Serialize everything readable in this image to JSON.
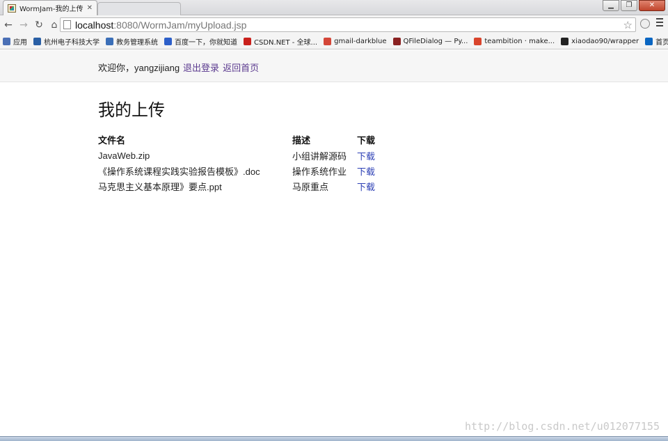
{
  "browser": {
    "active_tab_title": "WormJam-我的上传",
    "url_host": "localhost",
    "url_rest": ":8080/WormJam/myUpload.jsp",
    "bookmarks": [
      {
        "label": "应用",
        "icon": "apps-grid-icon",
        "color": "#4a6fb5"
      },
      {
        "label": "杭州电子科技大学",
        "icon": "hdu-logo-icon",
        "color": "#2a5fa5"
      },
      {
        "label": "教务管理系统",
        "icon": "document-icon",
        "color": "#3b6fb8"
      },
      {
        "label": "百度一下，你就知道",
        "icon": "baidu-paw-icon",
        "color": "#2d5fc9"
      },
      {
        "label": "CSDN.NET - 全球...",
        "icon": "csdn-icon",
        "color": "#c9201c"
      },
      {
        "label": "gmail-darkblue",
        "icon": "gmail-icon",
        "color": "#d44638"
      },
      {
        "label": "QFileDialog — Py...",
        "icon": "qt-doc-icon",
        "color": "#8a2222"
      },
      {
        "label": "teambition · make...",
        "icon": "teambition-icon",
        "color": "#d9442c"
      },
      {
        "label": "xiaodao90/wrapper",
        "icon": "github-icon",
        "color": "#222222"
      },
      {
        "label": "首页 - 知乎",
        "icon": "zhihu-icon",
        "color": "#0a66c2"
      }
    ],
    "bookmarks_overflow": "»"
  },
  "header": {
    "welcome_text": "欢迎你，yangzijiang",
    "logout_link": "退出登录",
    "home_link": "返回首页"
  },
  "main": {
    "title": "我的上传",
    "columns": [
      "文件名",
      "描述",
      "下载"
    ],
    "rows": [
      {
        "name": "JavaWeb.zip",
        "desc": "小组讲解源码",
        "download": "下载"
      },
      {
        "name": "《操作系统课程实践实验报告模板》.doc",
        "desc": "操作系统作业",
        "download": "下载"
      },
      {
        "name": "马克思主义基本原理》要点.ppt",
        "desc": "马原重点",
        "download": "下载"
      }
    ]
  },
  "watermark": "http://blog.csdn.net/u012077155",
  "colors": {
    "link": "#2c3fb5",
    "visited_link": "#5b3a8f"
  }
}
